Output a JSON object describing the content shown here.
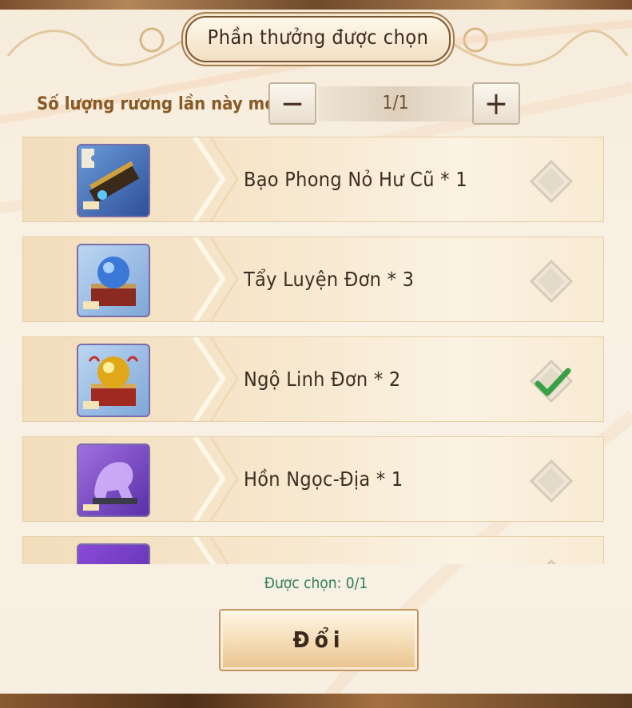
{
  "dialog": {
    "title": "Phần thưởng được chọn"
  },
  "quantity": {
    "label": "Số lượng rương lần này mở",
    "minus_icon": "minus-icon",
    "plus_icon": "plus-icon",
    "value": "1/1"
  },
  "rewards": [
    {
      "name": "Bạo Phong Nỏ Hư Cũ * 1",
      "icon": "ballista-puzzle-icon",
      "checked": false
    },
    {
      "name": "Tẩy Luyện Đơn * 3",
      "icon": "blue-orb-chest-icon",
      "checked": false
    },
    {
      "name": "Ngộ Linh Đơn * 2",
      "icon": "golden-orb-chest-icon",
      "checked": true
    },
    {
      "name": "Hồn Ngọc-Địa * 1",
      "icon": "purple-qilin-statue-icon",
      "checked": false
    },
    {
      "name": "",
      "icon": "purple-item-icon",
      "checked": false
    }
  ],
  "selection": {
    "status": "Được chọn: 0/1"
  },
  "actions": {
    "submit_label": "Đổi"
  },
  "colors": {
    "title_text": "#3a2a1e",
    "quantity_label": "#8a5a26",
    "selected_status": "#2f7d5a",
    "check_mark": "#3aa046"
  }
}
